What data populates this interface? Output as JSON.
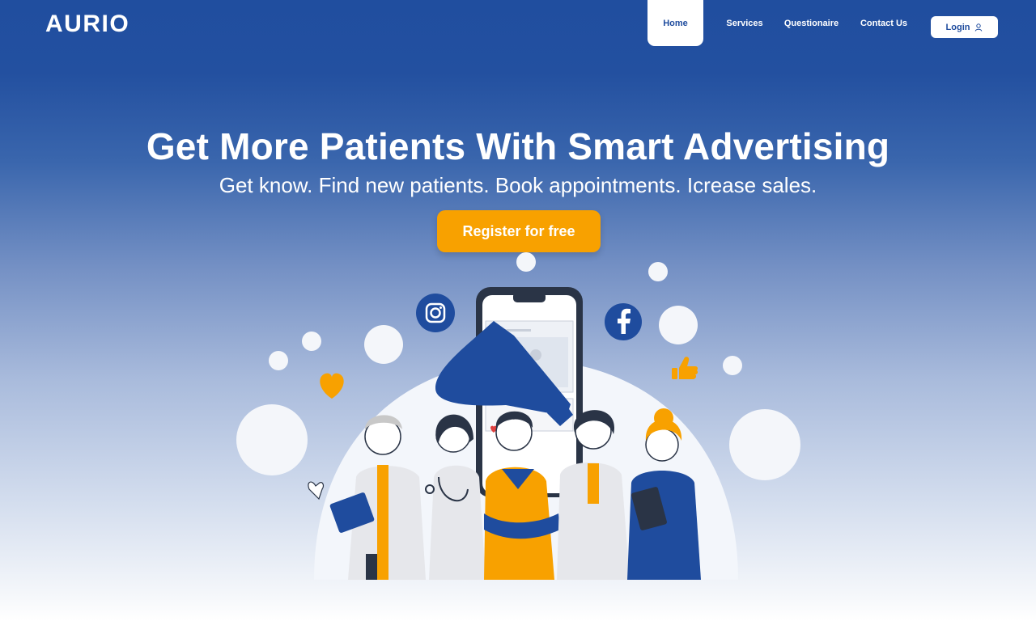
{
  "brand": {
    "name": "AURIO"
  },
  "nav": {
    "items": [
      {
        "label": "Home",
        "active": true
      },
      {
        "label": "Services"
      },
      {
        "label": "Questionaire"
      },
      {
        "label": "Contact Us"
      }
    ],
    "login_label": "Login"
  },
  "hero": {
    "title": "Get More Patients With Smart Advertising",
    "subtitle": "Get know. Find new patients. Book appointments. Icrease sales.",
    "cta_label": "Register for free"
  },
  "colors": {
    "primary": "#204e9f",
    "accent": "#f8a100",
    "white": "#ffffff"
  },
  "illustration": {
    "icons": [
      "instagram-icon",
      "facebook-icon",
      "heart-icon",
      "thumbs-up-icon",
      "megaphone-icon",
      "smartphone-icon"
    ]
  }
}
